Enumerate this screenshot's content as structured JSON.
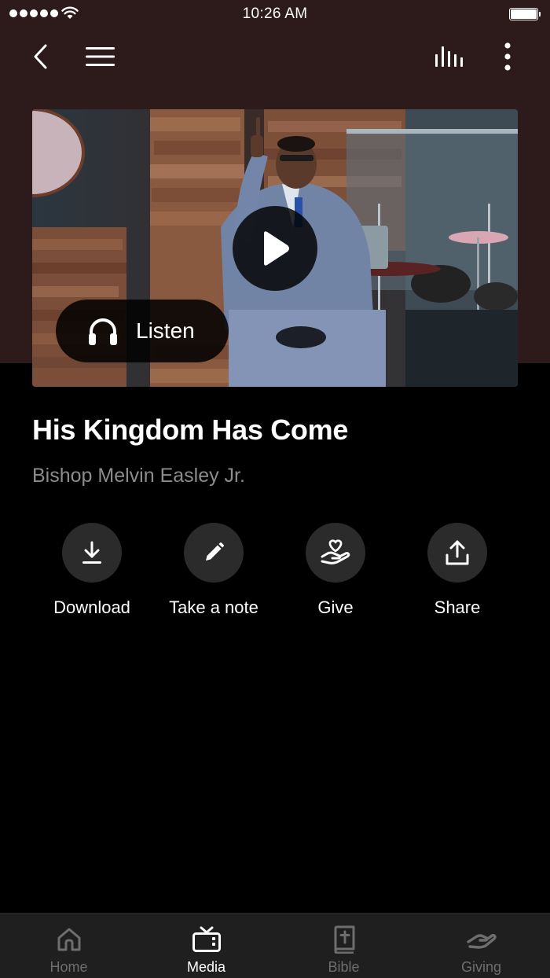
{
  "status_bar": {
    "time": "10:26 AM",
    "signal_icon": "signal-dots-icon",
    "wifi_icon": "wifi-icon",
    "battery_icon": "battery-icon"
  },
  "top_nav": {
    "back_icon": "chevron-left-icon",
    "menu_icon": "hamburger-menu-icon",
    "audio_icon": "equalizer-icon",
    "more_icon": "more-vertical-icon"
  },
  "video": {
    "play_icon": "play-icon",
    "listen_label": "Listen",
    "listen_icon": "headphones-icon"
  },
  "sermon": {
    "title": "His Kingdom Has Come",
    "speaker": "Bishop Melvin Easley Jr."
  },
  "actions": [
    {
      "label": "Download",
      "icon": "download-icon"
    },
    {
      "label": "Take a note",
      "icon": "pencil-icon"
    },
    {
      "label": "Give",
      "icon": "give-hand-heart-icon"
    },
    {
      "label": "Share",
      "icon": "share-upload-icon"
    }
  ],
  "tab_bar": {
    "active_tab": "Media",
    "tabs": [
      {
        "label": "Home",
        "icon": "home-icon"
      },
      {
        "label": "Media",
        "icon": "tv-icon"
      },
      {
        "label": "Bible",
        "icon": "bible-icon"
      },
      {
        "label": "Giving",
        "icon": "giving-hand-icon"
      }
    ]
  },
  "colors": {
    "header_background": "#2d1a1a",
    "page_background": "#000000",
    "secondary_text": "#8c8c8c",
    "action_circle": "#2b2b2b",
    "tab_bar_background": "#1f1f1f",
    "tab_inactive": "#6e6e6e",
    "tab_active": "#ffffff"
  }
}
